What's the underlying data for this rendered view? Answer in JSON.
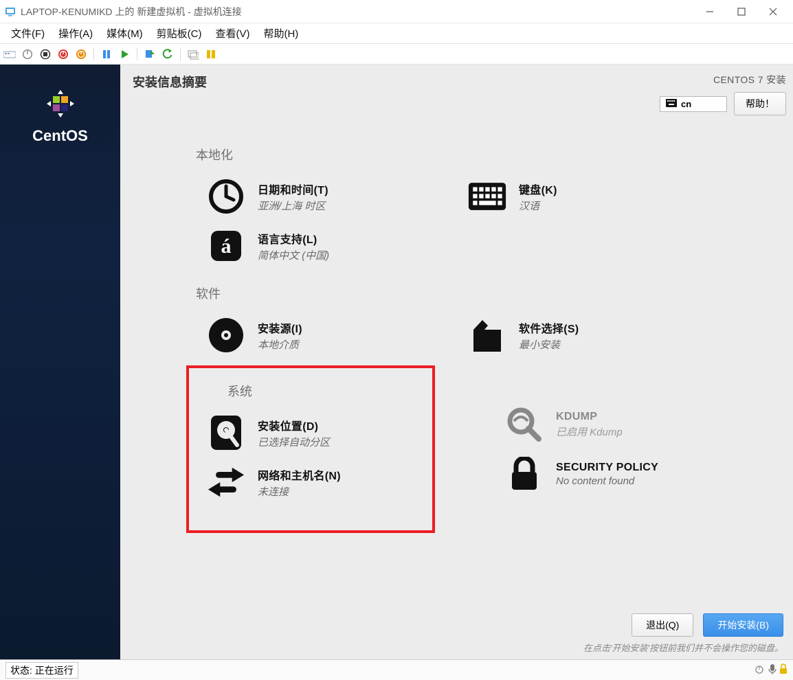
{
  "window": {
    "title": "LAPTOP-KENUMIKD 上的 新建虚拟机 - 虚拟机连接"
  },
  "menu": {
    "file": "文件(F)",
    "action": "操作(A)",
    "media": "媒体(M)",
    "clipboard": "剪贴板(C)",
    "view": "查看(V)",
    "help": "帮助(H)"
  },
  "sidebar": {
    "brand": "CentOS"
  },
  "header": {
    "page_title": "安装信息摘要",
    "distro": "CENTOS 7 安装",
    "lang_indicator": "cn",
    "help_btn": "帮助！"
  },
  "categories": {
    "localization": {
      "title": "本地化"
    },
    "software": {
      "title": "软件"
    },
    "system": {
      "title": "系统"
    }
  },
  "spokes": {
    "datetime": {
      "label": "日期和时间(T)",
      "sub": "亚洲/上海 时区"
    },
    "keyboard": {
      "label": "键盘(K)",
      "sub": "汉语"
    },
    "langsupport": {
      "label": "语言支持(L)",
      "sub": "简体中文 (中国)"
    },
    "source": {
      "label": "安装源(I)",
      "sub": "本地介质"
    },
    "software_sel": {
      "label": "软件选择(S)",
      "sub": "最小安装"
    },
    "destination": {
      "label": "安装位置(D)",
      "sub": "已选择自动分区"
    },
    "kdump": {
      "label": "KDUMP",
      "sub": "已启用 Kdump"
    },
    "network": {
      "label": "网络和主机名(N)",
      "sub": "未连接"
    },
    "security": {
      "label": "SECURITY POLICY",
      "sub": "No content found"
    }
  },
  "footer": {
    "quit": "退出(Q)",
    "begin": "开始安装(B)",
    "hint": "在点击'开始安装'按钮前我们并不会操作您的磁盘。"
  },
  "status": {
    "label": "状态:",
    "value": "正在运行"
  }
}
